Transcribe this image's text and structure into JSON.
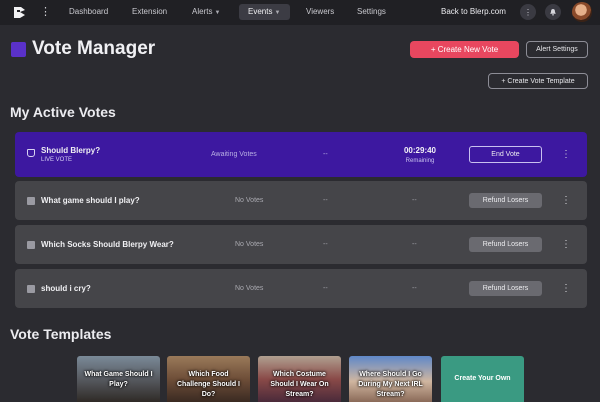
{
  "nav": {
    "items": [
      {
        "label": "Dashboard"
      },
      {
        "label": "Extension"
      },
      {
        "label": "Alerts"
      },
      {
        "label": "Events"
      },
      {
        "label": "Viewers"
      },
      {
        "label": "Settings"
      }
    ],
    "back_link": "Back to Blerp.com"
  },
  "header": {
    "title": "Vote Manager",
    "create_button": "+ Create New Vote",
    "alert_settings_button": "Alert Settings",
    "create_template_button": "+ Create Vote Template"
  },
  "active_votes": {
    "heading": "My Active Votes",
    "rows": [
      {
        "title": "Should Blerpy?",
        "sub": "LIVE VOTE",
        "status": "Awaiting Votes",
        "dash": "--",
        "timer": "00:29:40",
        "timer_sub": "Remaining",
        "action": "End Vote"
      },
      {
        "title": "What game should I play?",
        "status": "No Votes",
        "dash1": "--",
        "dash2": "--",
        "action": "Refund Losers"
      },
      {
        "title": "Which Socks Should Blerpy Wear?",
        "status": "No Votes",
        "dash1": "--",
        "dash2": "--",
        "action": "Refund Losers"
      },
      {
        "title": "should i cry?",
        "status": "No Votes",
        "dash1": "--",
        "dash2": "--",
        "action": "Refund Losers"
      }
    ]
  },
  "templates": {
    "heading": "Vote Templates",
    "cards": [
      {
        "label": "What Game Should I Play?"
      },
      {
        "label": "Which Food Challenge Should I Do?"
      },
      {
        "label": "Which Costume Should I Wear On Stream?"
      },
      {
        "label": "Where Should I Go During My Next IRL Stream?"
      },
      {
        "label": "Create Your Own"
      }
    ]
  },
  "colors": {
    "accent_purple": "#3d18a0",
    "primary_red": "#e8475f",
    "create_green": "#3a9a82"
  },
  "icons": {
    "logo": "blerp-logo",
    "notifications": "bell-icon",
    "more": "kebab-icon"
  }
}
